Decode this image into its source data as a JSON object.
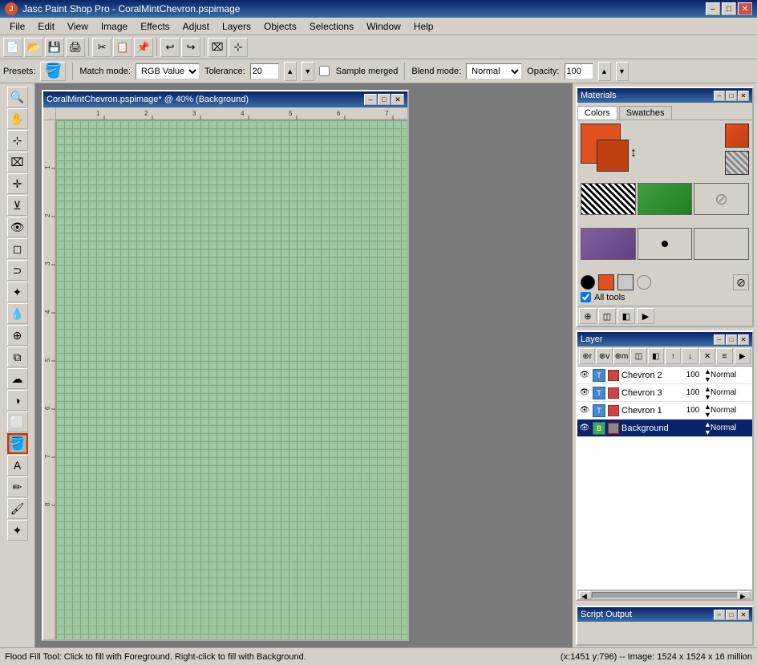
{
  "titlebar": {
    "title": "Jasc Paint Shop Pro - CoralMintChevron.pspimage",
    "icon_label": "J",
    "min_label": "–",
    "max_label": "□",
    "close_label": "✕"
  },
  "menu": {
    "items": [
      "File",
      "Edit",
      "View",
      "Image",
      "Effects",
      "Adjust",
      "Layers",
      "Objects",
      "Selections",
      "Window",
      "Help"
    ]
  },
  "toolbar1": {
    "buttons": [
      "📄",
      "📂",
      "💾",
      "🖨",
      "✂",
      "📋",
      "↩",
      "↪",
      "✂",
      "📋"
    ]
  },
  "toolbar2": {
    "presets_label": "Presets:",
    "match_mode_label": "Match mode:",
    "match_mode_value": "RGB Value",
    "tolerance_label": "Tolerance:",
    "tolerance_value": "20",
    "sample_merged_label": "Sample merged",
    "blend_mode_label": "Blend mode:",
    "blend_mode_value": "Normal",
    "opacity_label": "Opacity:",
    "opacity_value": "100"
  },
  "canvas": {
    "title": "CoralMintChevron.pspimage* @ 40% (Background)",
    "min_label": "–",
    "max_label": "□",
    "close_label": "✕"
  },
  "tools": {
    "zoom": "🔍",
    "pan": "✋",
    "deform": "⊹",
    "crop": "⌧",
    "move": "✛",
    "straighten": "⊻",
    "red_eye": "👁",
    "selection": "◻",
    "lasso": "⊂",
    "magic_wand": "✦",
    "dropper": "💧",
    "paint_bucket": "🪣",
    "text": "A",
    "draw": "✏",
    "paint": "🖌",
    "airbrush": "✦",
    "clone": "🔄",
    "smear": "☁",
    "dodge": "◑",
    "erase": "⬜",
    "fill_active": "🪣"
  },
  "materials": {
    "panel_title": "Materials",
    "tabs": [
      "Colors",
      "Swatches"
    ],
    "active_tab": "Colors",
    "fg_color": "#e05020",
    "bg_color": "#d05018",
    "swatches": [
      {
        "type": "zebra"
      },
      {
        "type": "green"
      },
      {
        "type": "circle-x"
      },
      {
        "type": "purple"
      },
      {
        "type": "white-dot"
      },
      {
        "type": "blank"
      }
    ],
    "all_tools_label": "All tools",
    "bottom_btns": [
      "⊕",
      "◫",
      "◧",
      "▶"
    ]
  },
  "layers": {
    "panel_title": "Layer",
    "toolbar_btns": [
      "⊕",
      "⊕",
      "⊕",
      "◫",
      "◧",
      "↑",
      "↓",
      "✕",
      "≡"
    ],
    "rows": [
      {
        "name": "Chevron 2",
        "opacity": "100",
        "blend": "Normal",
        "visible": true,
        "selected": false
      },
      {
        "name": "Chevron 3",
        "opacity": "100",
        "blend": "Normal",
        "visible": true,
        "selected": false
      },
      {
        "name": "Chevron 1",
        "opacity": "100",
        "blend": "Normal",
        "visible": true,
        "selected": false
      },
      {
        "name": "Background",
        "opacity": "",
        "blend": "Normal",
        "visible": true,
        "selected": true
      }
    ]
  },
  "script_output": {
    "title": "Script Output"
  },
  "statusbar": {
    "tool_hint": "Flood Fill Tool: Click to fill with Foreground. Right-click to fill with Background.",
    "coords": "(x:1451 y:796) -- Image: 1524 x 1524 x 16 million"
  }
}
